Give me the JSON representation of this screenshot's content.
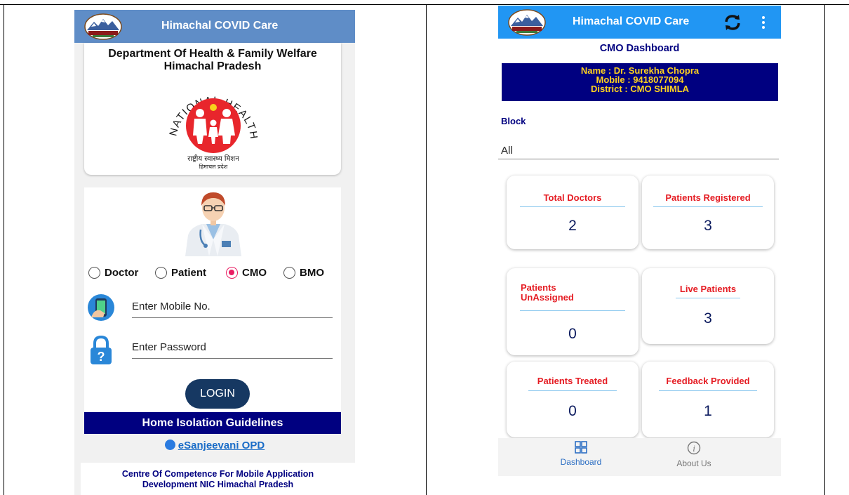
{
  "left": {
    "app_title": "Himachal COVID Care",
    "dept": {
      "line1": "Department Of Health & Family Welfare",
      "line2": "Himachal Pradesh"
    },
    "logo": {
      "arc_text": "NATIONAL HEALTH MISSION",
      "hindi_line1": "राष्ट्रीय स्वास्थ्य मिशन",
      "hindi_line2": "हिमाचल प्रदेश"
    },
    "roles": [
      {
        "label": "Doctor",
        "selected": false
      },
      {
        "label": "Patient",
        "selected": false
      },
      {
        "label": "CMO",
        "selected": true
      },
      {
        "label": "BMO",
        "selected": false
      }
    ],
    "mobile_placeholder": "Enter Mobile No.",
    "password_placeholder": "Enter Password",
    "login_label": "LOGIN",
    "guidelines_label": "Home Isolation Guidelines",
    "esanjeevani_label": "eSanjeevani OPD",
    "footer": {
      "line1": "Centre Of Competence For Mobile Application",
      "line2": "Development NIC Himachal Pradesh"
    }
  },
  "right": {
    "app_title": "Himachal COVID Care",
    "dashboard_title": "CMO Dashboard",
    "info": {
      "name": "Name : Dr. Surekha Chopra",
      "mobile": "Mobile : 9418077094",
      "district": "District : CMO SHIMLA"
    },
    "block_label": "Block",
    "block_value": "All",
    "cards": [
      {
        "label": "Total Doctors",
        "value": "2"
      },
      {
        "label": "Patients Registered",
        "value": "3"
      },
      {
        "label_line1": "Patients",
        "label_line2": "UnAssigned",
        "value": "0"
      },
      {
        "label": "Live Patients",
        "value": "3"
      },
      {
        "label": "Patients Treated",
        "value": "0"
      },
      {
        "label": "Feedback Provided",
        "value": "1"
      }
    ],
    "nav": [
      {
        "label": "Dashboard",
        "icon": "dashboard-grid-icon",
        "active": true
      },
      {
        "label": "About Us",
        "icon": "info-icon",
        "active": false
      }
    ]
  },
  "colors": {
    "left_appbar": "#5f8dc7",
    "right_appbar": "#2196f3",
    "navy": "#000080",
    "accent_red": "#e51c23",
    "radio_selected": "#e91e63",
    "login_button": "#163862"
  }
}
